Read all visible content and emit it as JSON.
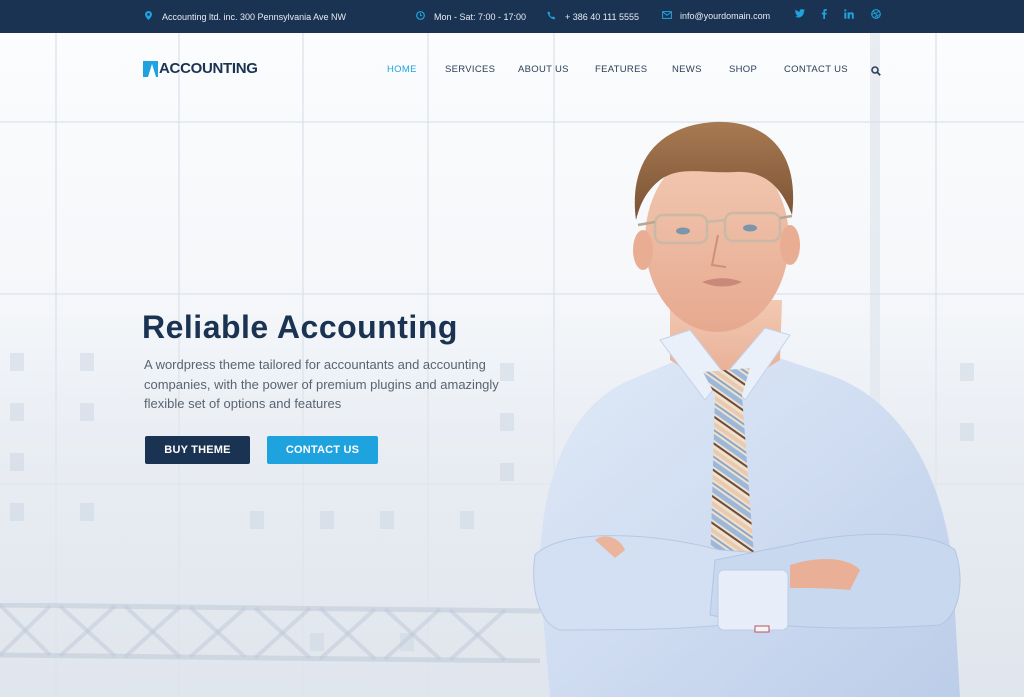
{
  "topbar": {
    "address": "Accounting ltd. inc. 300 Pennsylvania Ave NW",
    "hours": "Mon - Sat: 7:00 - 17:00",
    "phone": "+ 386 40 111 5555",
    "email": "info@yourdomain.com",
    "icons": {
      "address": "map-pin-icon",
      "hours": "clock-icon",
      "phone": "phone-icon",
      "email": "envelope-icon"
    },
    "social": [
      {
        "name": "twitter",
        "glyph": "t"
      },
      {
        "name": "facebook",
        "glyph": "f"
      },
      {
        "name": "linkedin",
        "glyph": "in"
      },
      {
        "name": "dribbble",
        "glyph": "◎"
      }
    ]
  },
  "logo": {
    "text": "ACCOUNTING"
  },
  "nav": {
    "items": [
      {
        "label": "HOME",
        "active": true
      },
      {
        "label": "SERVICES",
        "active": false
      },
      {
        "label": "ABOUT US",
        "active": false
      },
      {
        "label": "FEATURES",
        "active": false
      },
      {
        "label": "NEWS",
        "active": false
      },
      {
        "label": "SHOP",
        "active": false
      },
      {
        "label": "CONTACT US",
        "active": false
      }
    ],
    "search_icon": "search-icon"
  },
  "hero": {
    "title": "Reliable Accounting",
    "description": "A wordpress theme tailored for accountants and accounting companies, with the power of premium plugins and amazingly flexible set of options and features",
    "buttons": {
      "primary": "BUY THEME",
      "secondary": "CONTACT US"
    },
    "image": "businessman-with-crossed-arms"
  },
  "colors": {
    "navy": "#1b3352",
    "accent": "#1fa3df",
    "body_text": "#5a6470"
  }
}
